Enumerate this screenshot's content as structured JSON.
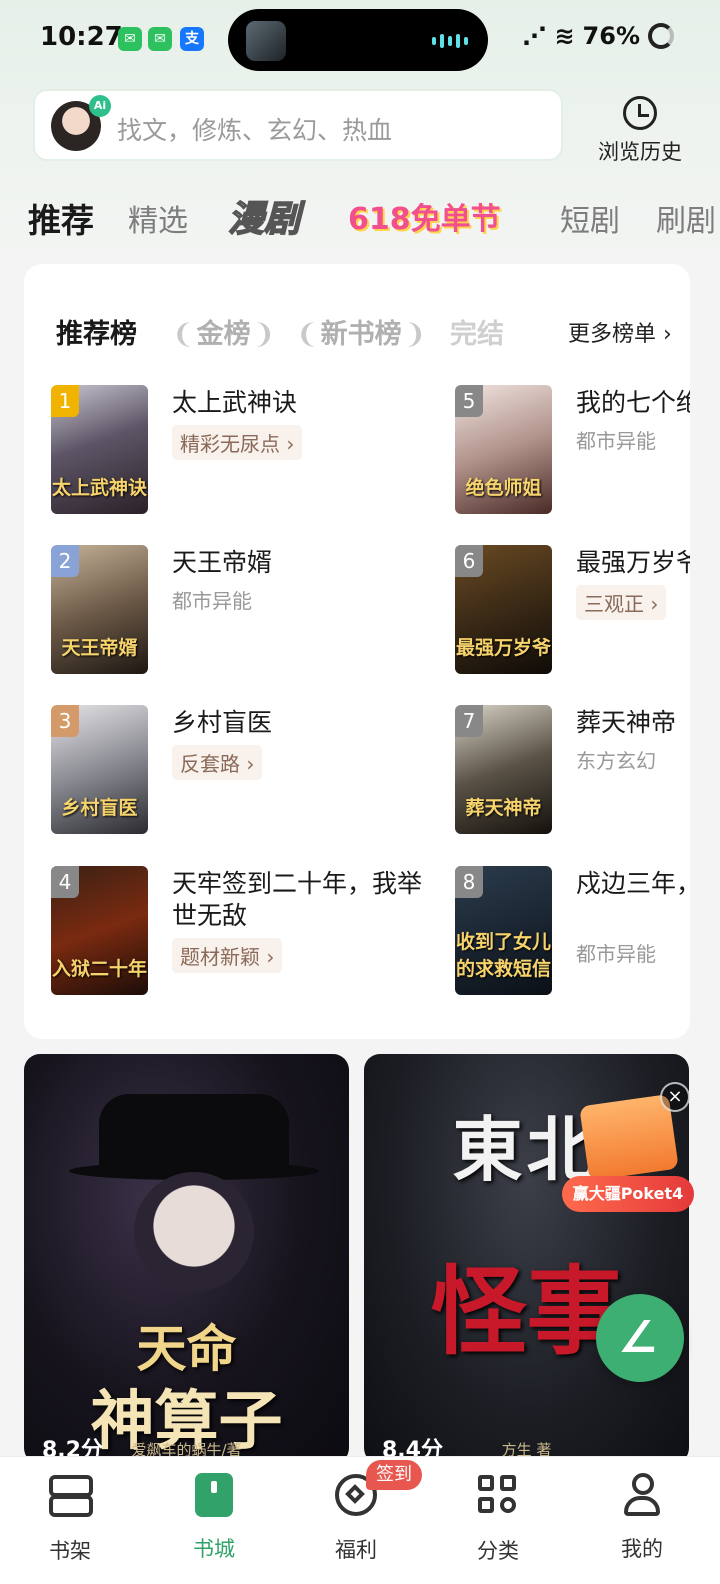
{
  "status_bar": {
    "time": "10:27",
    "battery": "76%",
    "apps": [
      {
        "name": "wechat-icon",
        "glyph": "✉",
        "color": "#2dc160"
      },
      {
        "name": "wechat-icon-2",
        "glyph": "✉",
        "color": "#2dc160"
      },
      {
        "name": "alipay-icon",
        "glyph": "支",
        "color": "#1677ff"
      }
    ]
  },
  "search": {
    "placeholder": "找文，修炼、玄幻、热血",
    "ai_tag": "Ai",
    "history_label": "浏览历史"
  },
  "channel_tabs": [
    {
      "label": "推荐",
      "active": true
    },
    {
      "label": "精选"
    },
    {
      "label": "漫剧"
    },
    {
      "label": "618免单节"
    },
    {
      "label": "短剧"
    },
    {
      "label": "刷剧"
    }
  ],
  "ranking": {
    "tabs": [
      "推荐榜",
      "金榜",
      "新书榜",
      "完结"
    ],
    "more_label": "更多榜单",
    "books": [
      {
        "rank": "1",
        "title": "太上武神诀",
        "tag": "精彩无尿点",
        "chip": true,
        "cover_text": "太上武神诀",
        "rank_color": "#f0b400",
        "cover": "linear-gradient(160deg,#c9c6d1 0%,#5d5566 45%,#2a2128 100%)"
      },
      {
        "rank": "2",
        "title": "天王帝婿",
        "tag": "都市异能",
        "chip": false,
        "cover_text": "天王帝婿",
        "rank_color": "#8aa3d6",
        "cover": "linear-gradient(160deg,#c7b39a 0%,#6e5b48 50%,#1d1712 100%)"
      },
      {
        "rank": "3",
        "title": "乡村盲医",
        "tag": "反套路",
        "chip": true,
        "cover_text": "乡村盲医",
        "rank_color": "#d49a6a",
        "cover": "linear-gradient(160deg,#e5e5e8 0%,#8a8a92 50%,#2a2a30 100%)"
      },
      {
        "rank": "4",
        "title": "天牢签到二十年，我举世无敌",
        "tag": "题材新颖",
        "chip": true,
        "cover_text": "入狱二十年",
        "rank_color": "#888888",
        "cover": "linear-gradient(160deg,#3a2114 0%,#7a2a10 50%,#1c0d08 100%)"
      },
      {
        "rank": "5",
        "title": "我的七个绝色师姐",
        "tag": "都市异能",
        "chip": false,
        "cover_text": "绝色师姐",
        "rank_color": "#888888",
        "cover": "linear-gradient(160deg,#f1e4e1 0%,#b1938b 50%,#4a2a26 100%)"
      },
      {
        "rank": "6",
        "title": "最强万岁爷",
        "tag": "三观正",
        "chip": true,
        "cover_text": "最强万岁爷",
        "rank_color": "#888888",
        "cover": "linear-gradient(160deg,#6a4a22 0%,#3b2a16 50%,#0f0b08 100%)"
      },
      {
        "rank": "7",
        "title": "葬天神帝",
        "tag": "东方玄幻",
        "chip": false,
        "cover_text": "葬天神帝",
        "rank_color": "#888888",
        "cover": "linear-gradient(160deg,#d9d3c8 0%,#5a5246 50%,#14110d 100%)"
      },
      {
        "rank": "8",
        "title": "戍边三年，收到了女儿的求救短信",
        "tag": "都市异能",
        "chip": false,
        "cover_text": "收到了女儿的求救短信",
        "rank_color": "#888888",
        "cover": "linear-gradient(160deg,#2b3c4c 0%,#1b2633 50%,#0b1016 100%)"
      }
    ]
  },
  "features": [
    {
      "title_1": "天命",
      "title_2": "神算子",
      "author": "爱飙车的蜗牛/著",
      "score": "8.2分"
    },
    {
      "title_1": "東北",
      "title_2": "怪事",
      "author": "方生 著",
      "score": "8.4分"
    }
  ],
  "promo": {
    "badge": "赢大疆Poket4",
    "close": "×"
  },
  "bottom_nav": [
    {
      "label": "书架"
    },
    {
      "label": "书城",
      "active": true
    },
    {
      "label": "福利"
    },
    {
      "label": "分类"
    },
    {
      "label": "我的"
    }
  ],
  "checkin_badge": "签到",
  "accent": "#31a36a"
}
